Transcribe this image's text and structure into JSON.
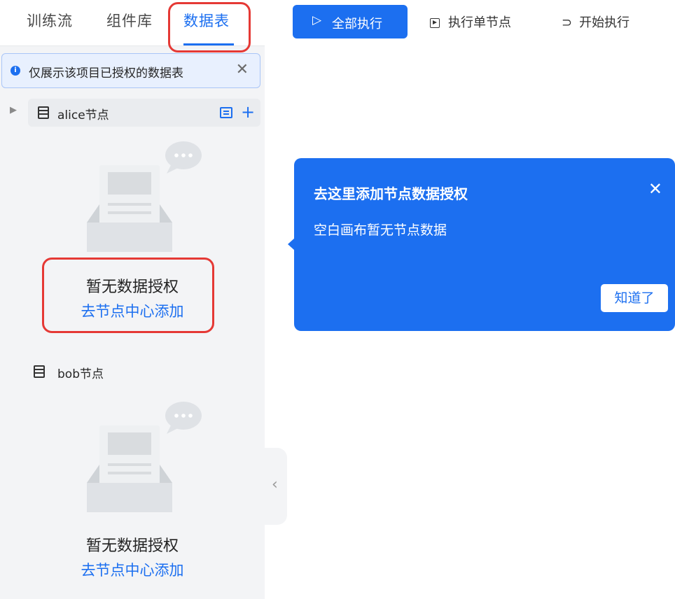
{
  "tabs": [
    {
      "label": "训练流"
    },
    {
      "label": "组件库"
    },
    {
      "label": "数据表"
    }
  ],
  "notice": {
    "text": "仅展示该项目已授权的数据表",
    "info_icon": "i",
    "close_icon": "✕"
  },
  "nodes": [
    {
      "label": "alice节点",
      "empty_title": "暂无数据授权",
      "empty_link": "去节点中心添加"
    },
    {
      "label": "bob节点",
      "empty_title": "暂无数据授权",
      "empty_link": "去节点中心添加"
    }
  ],
  "row_actions": {
    "expand_icon": "▶",
    "add_icon": "+"
  },
  "toolbar": {
    "run_all_icon": "▷",
    "run_all": "全部执行",
    "run_single": "执行单节点",
    "start_icon": "⊃",
    "start": "开始执行"
  },
  "collapse_icon": "‹",
  "popover": {
    "title": "去这里添加节点数据授权",
    "description": "空白画布暂无节点数据",
    "close_icon": "✕",
    "ok": "知道了"
  },
  "colors": {
    "accent": "#1c6ff0",
    "highlight": "#e53935",
    "sidebar_bg": "#f3f4f6"
  }
}
